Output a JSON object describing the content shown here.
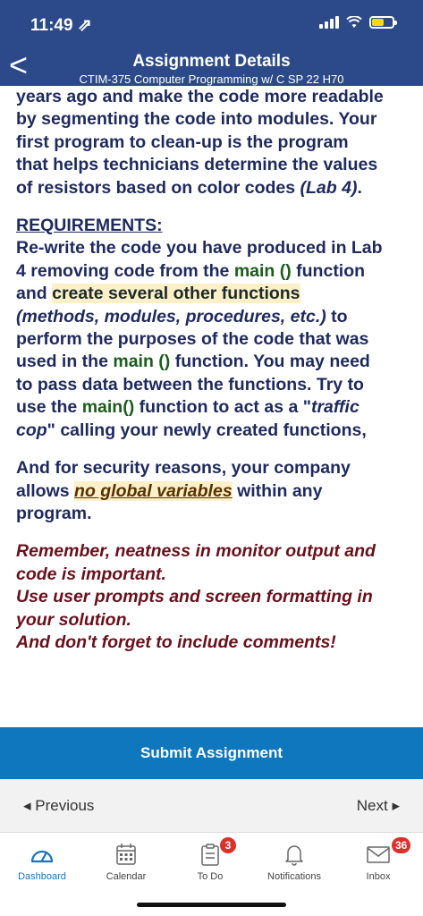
{
  "status": {
    "time": "11:49 ⇗"
  },
  "header": {
    "back": "<",
    "title": "Assignment Details",
    "subtitle": "CTIM-375 Computer Programming w/ C SP 22 H70"
  },
  "body": {
    "l0": "years ago and make the code more readable",
    "l1": "by segmenting the code into modules.  Your",
    "l2": "first program to clean-up is the program",
    "l3": "that helps technicians determine the values",
    "l4a": "of resistors based on color codes ",
    "l4b": "(Lab 4)",
    "l4c": ".",
    "req": "REQUIREMENTS:",
    "r1": "Re-write the code you have produced in Lab",
    "r2a": "4 removing code from the ",
    "r2b": "main ()",
    "r2c": " function",
    "r3a": "and ",
    "r3b": "create several other functions",
    "r4a": "(methods, modules, procedures, etc.)",
    "r4b": " to",
    "r5": "perform the purposes of the code that was",
    "r6a": "used in the ",
    "r6b": "main ()",
    "r6c": " function.  You may need",
    "r7": "to pass data between the functions.  Try to",
    "r8a": "use the ",
    "r8b": "main()",
    "r8c": " function to act as a \"",
    "r8d": "traffic",
    "r9a": "cop",
    "r9b": "\" calling your newly created functions,",
    "s1": "And for security reasons, your company",
    "s2a": "allows ",
    "s2b": "no global variables",
    "s2c": " within any",
    "s3": "program.",
    "m1": "Remember, neatness in monitor output and",
    "m2": "code is important.",
    "m3": "Use user prompts and screen formatting in",
    "m4": "your solution.",
    "m5": "And don't forget to include comments!"
  },
  "submit_label": "Submit Assignment",
  "nav": {
    "previous": "◂  Previous",
    "next": "Next  ▸"
  },
  "tabs": {
    "dashboard": "Dashboard",
    "calendar": "Calendar",
    "todo": "To Do",
    "todo_badge": "3",
    "notifications": "Notifications",
    "inbox": "Inbox",
    "inbox_badge": "36"
  },
  "colors": {
    "header": "#2c4a8a",
    "submit": "#0f77bd",
    "badge": "#d9312c",
    "active_tab": "#1a73c0"
  }
}
